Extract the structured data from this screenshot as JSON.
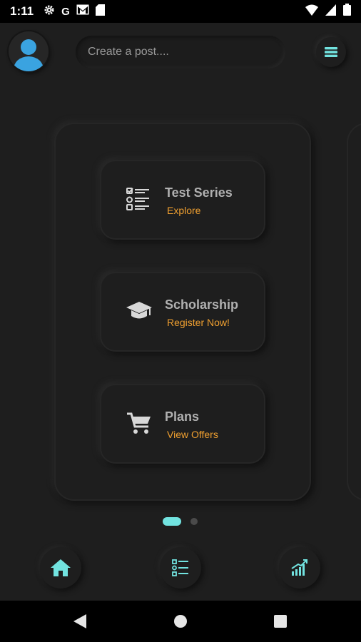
{
  "status_bar": {
    "time": "1:11",
    "left_icons": [
      "settings-icon",
      "google-icon",
      "gmail-icon",
      "sd-card-icon"
    ],
    "right_icons": [
      "wifi-icon",
      "signal-icon",
      "battery-icon"
    ]
  },
  "header": {
    "avatar_icon": "user-avatar-icon",
    "post_placeholder": "Create a post....",
    "menu_icon": "hamburger-menu-icon"
  },
  "cards": [
    {
      "title": "Test Series",
      "subtitle": "Explore",
      "icon": "checklist-icon"
    },
    {
      "title": "Scholarship",
      "subtitle": "Register Now!",
      "icon": "graduation-cap-icon"
    },
    {
      "title": "Plans",
      "subtitle": "View Offers",
      "icon": "cart-icon"
    }
  ],
  "pager": {
    "count": 2,
    "active_index": 0
  },
  "bottom_nav": [
    "home-icon",
    "list-icon",
    "chart-icon"
  ],
  "colors": {
    "background": "#1e1e1e",
    "accent": "#72e3e0",
    "subtitle": "#f0a030",
    "title": "#b0b0b0",
    "avatar": "#3aa3e0"
  }
}
